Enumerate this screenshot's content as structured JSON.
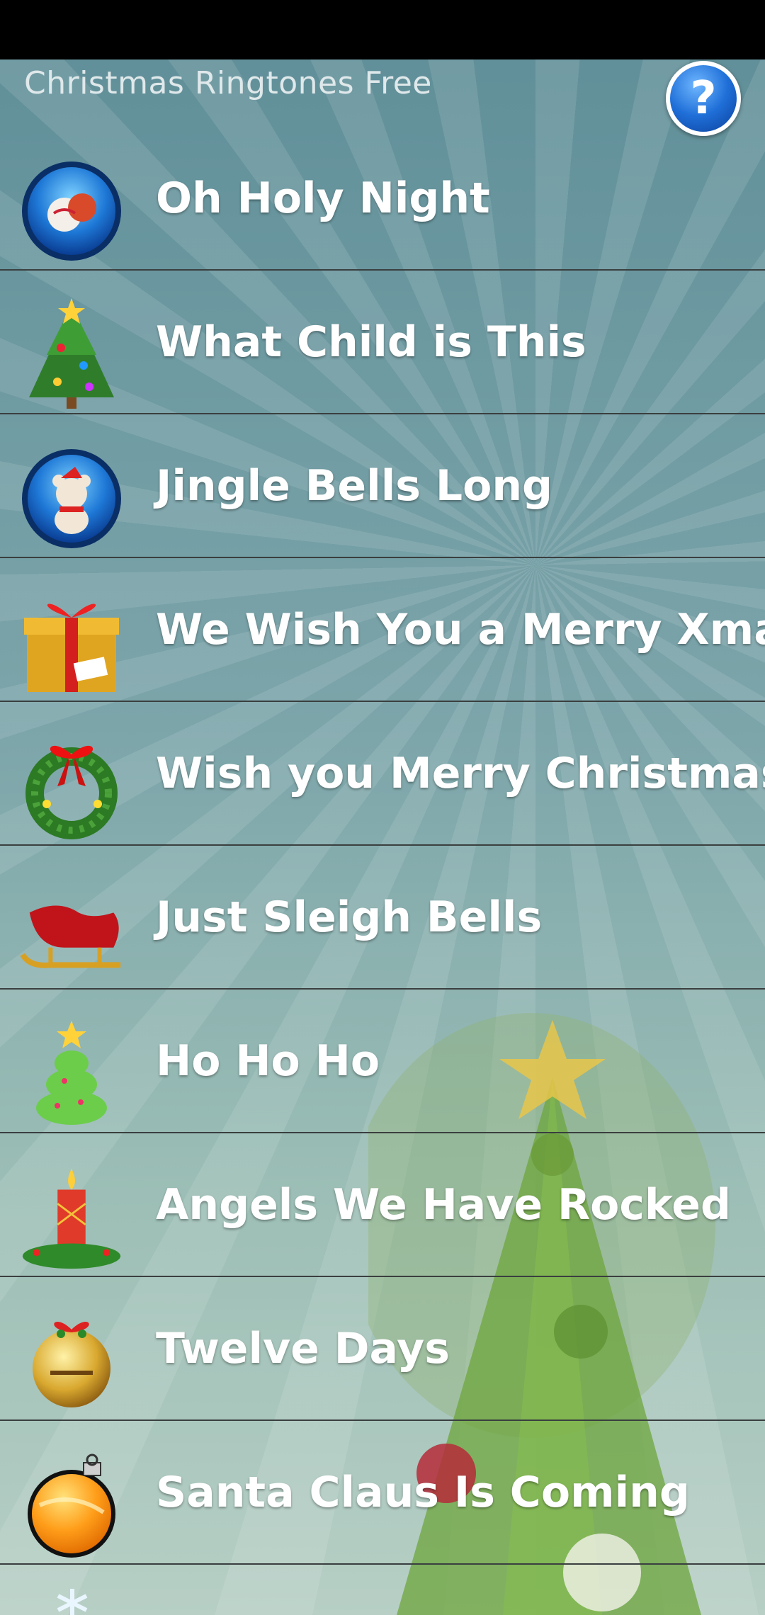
{
  "header": {
    "title": "Christmas Ringtones Free",
    "help_label": "?"
  },
  "ringtones": [
    {
      "label": "Oh Holy Night",
      "icon": "ornament-blue-icon"
    },
    {
      "label": "What Child is This",
      "icon": "christmas-tree-icon"
    },
    {
      "label": "Jingle Bells Long",
      "icon": "teddy-bear-blue-icon"
    },
    {
      "label": "We Wish You a Merry Xmas",
      "icon": "gift-box-icon"
    },
    {
      "label": "Wish you Merry Christmas",
      "icon": "wreath-icon"
    },
    {
      "label": "Just Sleigh Bells",
      "icon": "sleigh-icon"
    },
    {
      "label": "Ho Ho Ho",
      "icon": "small-tree-icon"
    },
    {
      "label": "Angels We Have Rocked",
      "icon": "candle-icon"
    },
    {
      "label": "Twelve Days",
      "icon": "jingle-bell-icon"
    },
    {
      "label": "Santa Claus Is Coming",
      "icon": "orange-ornament-icon"
    }
  ],
  "colors": {
    "status_bar": "#000000",
    "row_divider": "#3a3f3f",
    "label_text": "#ffffff",
    "title_text": "#dfe8ea"
  }
}
